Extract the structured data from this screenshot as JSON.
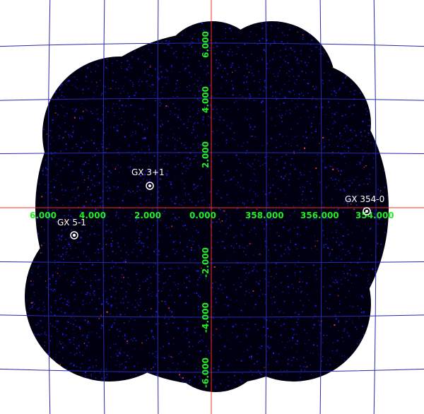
{
  "colors": {
    "background": "#ffffff",
    "field": "#000010",
    "grid": "#2a2ab0",
    "axis": "#ff2a2a",
    "tick_text": "#22ee22",
    "source_text": "#ffffff",
    "photon_low": "#2323ff",
    "photon_high": "#ff4040"
  },
  "axes": {
    "longitude_ticks": [
      "6.000",
      "4.000",
      "2.000",
      "0.000",
      "358.000",
      "356.000",
      "354.000"
    ],
    "latitude_ticks": [
      "6.000",
      "4.000",
      "2.000",
      "-2.000",
      "-4.000",
      "-6.000"
    ]
  },
  "sources": [
    {
      "name": "GX 3+1"
    },
    {
      "name": "GX 5-1"
    },
    {
      "name": "GX 354-0"
    }
  ]
}
